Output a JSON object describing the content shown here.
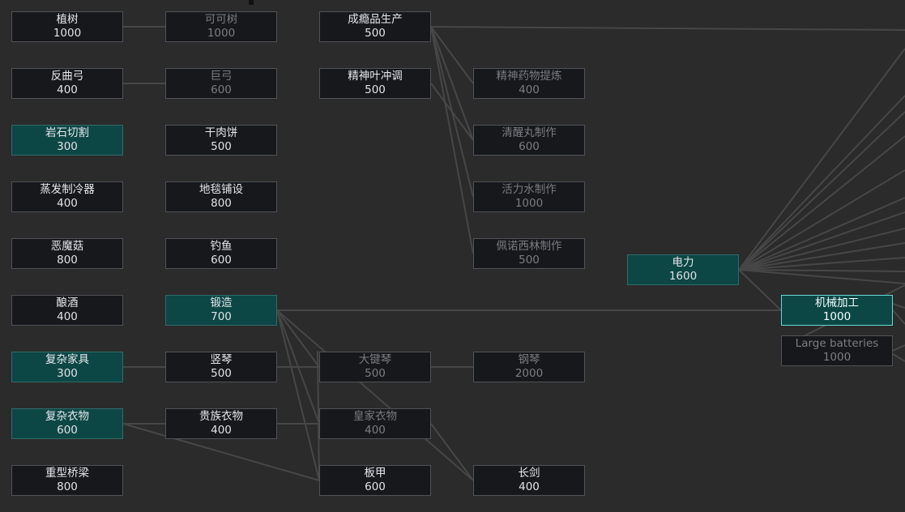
{
  "colors": {
    "background": "#2b2b2b",
    "edge": "#474747",
    "node_available": "#16181c",
    "node_researched": "#0d4745",
    "node_selected_border": "#66d8d2",
    "text_locked": "#7a7d82"
  },
  "nodes": [
    {
      "id": "tree_sowing",
      "name": "植树",
      "cost": "1000",
      "state": "available"
    },
    {
      "id": "recurve_bow",
      "name": "反曲弓",
      "cost": "400",
      "state": "available"
    },
    {
      "id": "stonecutting",
      "name": "岩石切割",
      "cost": "300",
      "state": "researched"
    },
    {
      "id": "passive_cooler",
      "name": "蒸发制冷器",
      "cost": "400",
      "state": "available"
    },
    {
      "id": "devilstrand",
      "name": "恶魔菇",
      "cost": "800",
      "state": "available"
    },
    {
      "id": "brewing",
      "name": "酿酒",
      "cost": "400",
      "state": "available"
    },
    {
      "id": "complex_furniture",
      "name": "复杂家具",
      "cost": "300",
      "state": "researched"
    },
    {
      "id": "complex_clothing",
      "name": "复杂衣物",
      "cost": "600",
      "state": "researched"
    },
    {
      "id": "heavy_bridge",
      "name": "重型桥梁",
      "cost": "800",
      "state": "available"
    },
    {
      "id": "cocoa",
      "name": "可可树",
      "cost": "1000",
      "state": "locked"
    },
    {
      "id": "greatbow",
      "name": "巨弓",
      "cost": "600",
      "state": "locked"
    },
    {
      "id": "pemmican",
      "name": "干肉饼",
      "cost": "500",
      "state": "available"
    },
    {
      "id": "carpets",
      "name": "地毯铺设",
      "cost": "800",
      "state": "available"
    },
    {
      "id": "fishing",
      "name": "钓鱼",
      "cost": "600",
      "state": "available"
    },
    {
      "id": "smithing",
      "name": "锻造",
      "cost": "700",
      "state": "researched"
    },
    {
      "id": "harp",
      "name": "竖琴",
      "cost": "500",
      "state": "available"
    },
    {
      "id": "noble_apparel",
      "name": "贵族衣物",
      "cost": "400",
      "state": "available"
    },
    {
      "id": "drug_production",
      "name": "成瘾品生产",
      "cost": "500",
      "state": "available"
    },
    {
      "id": "psychite_refining",
      "name": "精神叶冲调",
      "cost": "500",
      "state": "available"
    },
    {
      "id": "harpsichord",
      "name": "大键琴",
      "cost": "500",
      "state": "locked"
    },
    {
      "id": "royal_apparel",
      "name": "皇家衣物",
      "cost": "400",
      "state": "locked"
    },
    {
      "id": "plate_armor",
      "name": "板甲",
      "cost": "600",
      "state": "available"
    },
    {
      "id": "psychoid_brewing",
      "name": "精神药物提炼",
      "cost": "400",
      "state": "locked"
    },
    {
      "id": "wake_up",
      "name": "清醒丸制作",
      "cost": "600",
      "state": "locked"
    },
    {
      "id": "go_juice",
      "name": "活力水制作",
      "cost": "1000",
      "state": "locked"
    },
    {
      "id": "penoxycyline",
      "name": "佩诺西林制作",
      "cost": "500",
      "state": "locked"
    },
    {
      "id": "piano",
      "name": "钢琴",
      "cost": "2000",
      "state": "locked"
    },
    {
      "id": "long_blades",
      "name": "长剑",
      "cost": "400",
      "state": "available"
    },
    {
      "id": "electricity",
      "name": "电力",
      "cost": "1600",
      "state": "researched"
    },
    {
      "id": "machining",
      "name": "机械加工",
      "cost": "1000",
      "state": "selected"
    },
    {
      "id": "large_batteries",
      "name": "Large batteries",
      "cost": "1000",
      "state": "locked"
    }
  ]
}
